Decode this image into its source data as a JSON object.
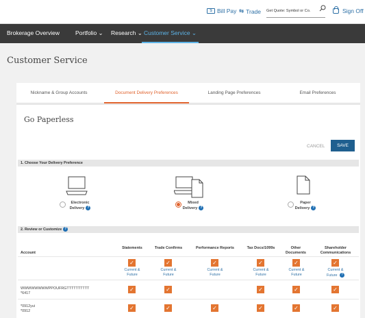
{
  "topbar": {
    "bill_pay_icon": "$",
    "bill_pay": "Bill Pay",
    "trade_icon": "⇆",
    "trade": "Trade",
    "quote_placeholder": "Get Quote: Symbol or Co.",
    "sign_off": "Sign Off"
  },
  "nav": {
    "items": [
      {
        "label": "Brokerage Overview"
      },
      {
        "label": "Portfolio ⌄"
      },
      {
        "label": "Research ⌄"
      },
      {
        "label": "Customer Service ⌄"
      }
    ]
  },
  "page_title": "Customer Service",
  "tabs": [
    "Nickname & Group Accounts",
    "Document Delivery Preferences",
    "Landing Page Preferences",
    "Email Preferences"
  ],
  "card": {
    "title": "Go Paperless",
    "cancel": "CANCEL",
    "save": "SAVE"
  },
  "section1": "1. Choose Your Delivery Preference",
  "delivery_options": [
    {
      "line1": "Electronic",
      "line2": "Delivery",
      "selected": false,
      "help": true
    },
    {
      "line1": "Mixed",
      "line2": "Delivery",
      "selected": true,
      "help": true
    },
    {
      "line1": "Paper",
      "line2": "Delivery",
      "selected": false,
      "help": true
    }
  ],
  "section2": "2. Review or Customize",
  "table": {
    "account_header": "Account",
    "columns": [
      {
        "line1": "",
        "line2": "Statements"
      },
      {
        "line1": "",
        "line2": "Trade Confirms"
      },
      {
        "line1": "",
        "line2": "Performance Reports"
      },
      {
        "line1": "",
        "line2": "Tax Docs/1099s"
      },
      {
        "line1": "Other",
        "line2": "Documents"
      },
      {
        "line1": "Shareholder",
        "line2": "Communications"
      }
    ],
    "freq_line1": "Current &",
    "freq_line2": "Future",
    "rows": [
      {
        "line1": "WWWWWWWWPPOUFRGTTTTTTTTTT",
        "line2": "*6417",
        "checks": [
          true,
          true,
          false,
          true,
          true,
          true
        ]
      },
      {
        "line1": "*0912yui",
        "line2": "*0912",
        "checks": [
          true,
          true,
          true,
          true,
          true,
          true
        ]
      }
    ]
  },
  "colors": {
    "accent": "#e0622c",
    "nav_bg": "#3a3a3a",
    "primary_button": "#1f5f8f",
    "link": "#2c6fa5"
  }
}
